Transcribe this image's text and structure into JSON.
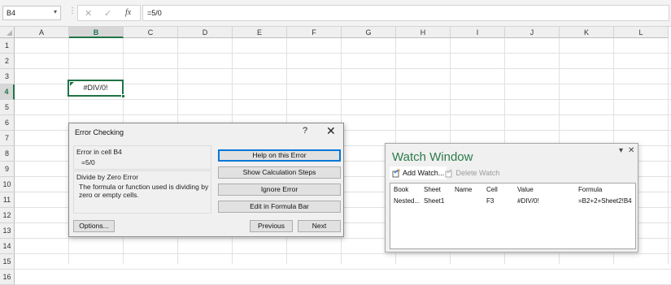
{
  "formula_bar": {
    "name_box": "B4",
    "cancel_glyph": "✕",
    "enter_glyph": "✓",
    "fx_label": "fx",
    "formula": "=5/0"
  },
  "sheet": {
    "columns": [
      "A",
      "B",
      "C",
      "D",
      "E",
      "F",
      "G",
      "H",
      "I",
      "J",
      "K",
      "L"
    ],
    "rows": [
      "1",
      "2",
      "3",
      "4",
      "5",
      "6",
      "7",
      "8",
      "9",
      "10",
      "11",
      "12",
      "13",
      "14",
      "15",
      "16"
    ],
    "selected_column": "B",
    "selected_row": "4",
    "active_cell_value": "#DIV/0!"
  },
  "error_dialog": {
    "title": "Error Checking",
    "help_glyph": "?",
    "close_glyph": "✕",
    "error_in_cell_label": "Error in cell B4",
    "cell_formula": "=5/0",
    "error_type": "Divide by Zero Error",
    "error_description": "The formula or function used is dividing by zero or empty cells.",
    "buttons": {
      "help": "Help on this Error",
      "show_steps": "Show Calculation Steps",
      "ignore": "Ignore Error",
      "edit": "Edit in Formula Bar",
      "options": "Options...",
      "previous": "Previous",
      "next": "Next"
    }
  },
  "watch_window": {
    "title": "Watch Window",
    "add_watch": "Add Watch...",
    "delete_watch": "Delete Watch",
    "columns": [
      "Book",
      "Sheet",
      "Name",
      "Cell",
      "Value",
      "Formula"
    ],
    "rows": [
      {
        "book": "Nested...",
        "sheet": "Sheet1",
        "name": "",
        "cell": "F3",
        "value": "#DIV/0!",
        "formula": "=B2+2+Sheet2!B4"
      }
    ]
  },
  "colors": {
    "accent_green": "#217346",
    "title_green": "#2c7a4b",
    "focus_blue": "#0078d7"
  },
  "icons": [
    "cancel-icon",
    "enter-icon",
    "fx-icon",
    "help-icon",
    "close-icon",
    "add-watch-icon",
    "delete-watch-icon",
    "dropdown-icon"
  ]
}
